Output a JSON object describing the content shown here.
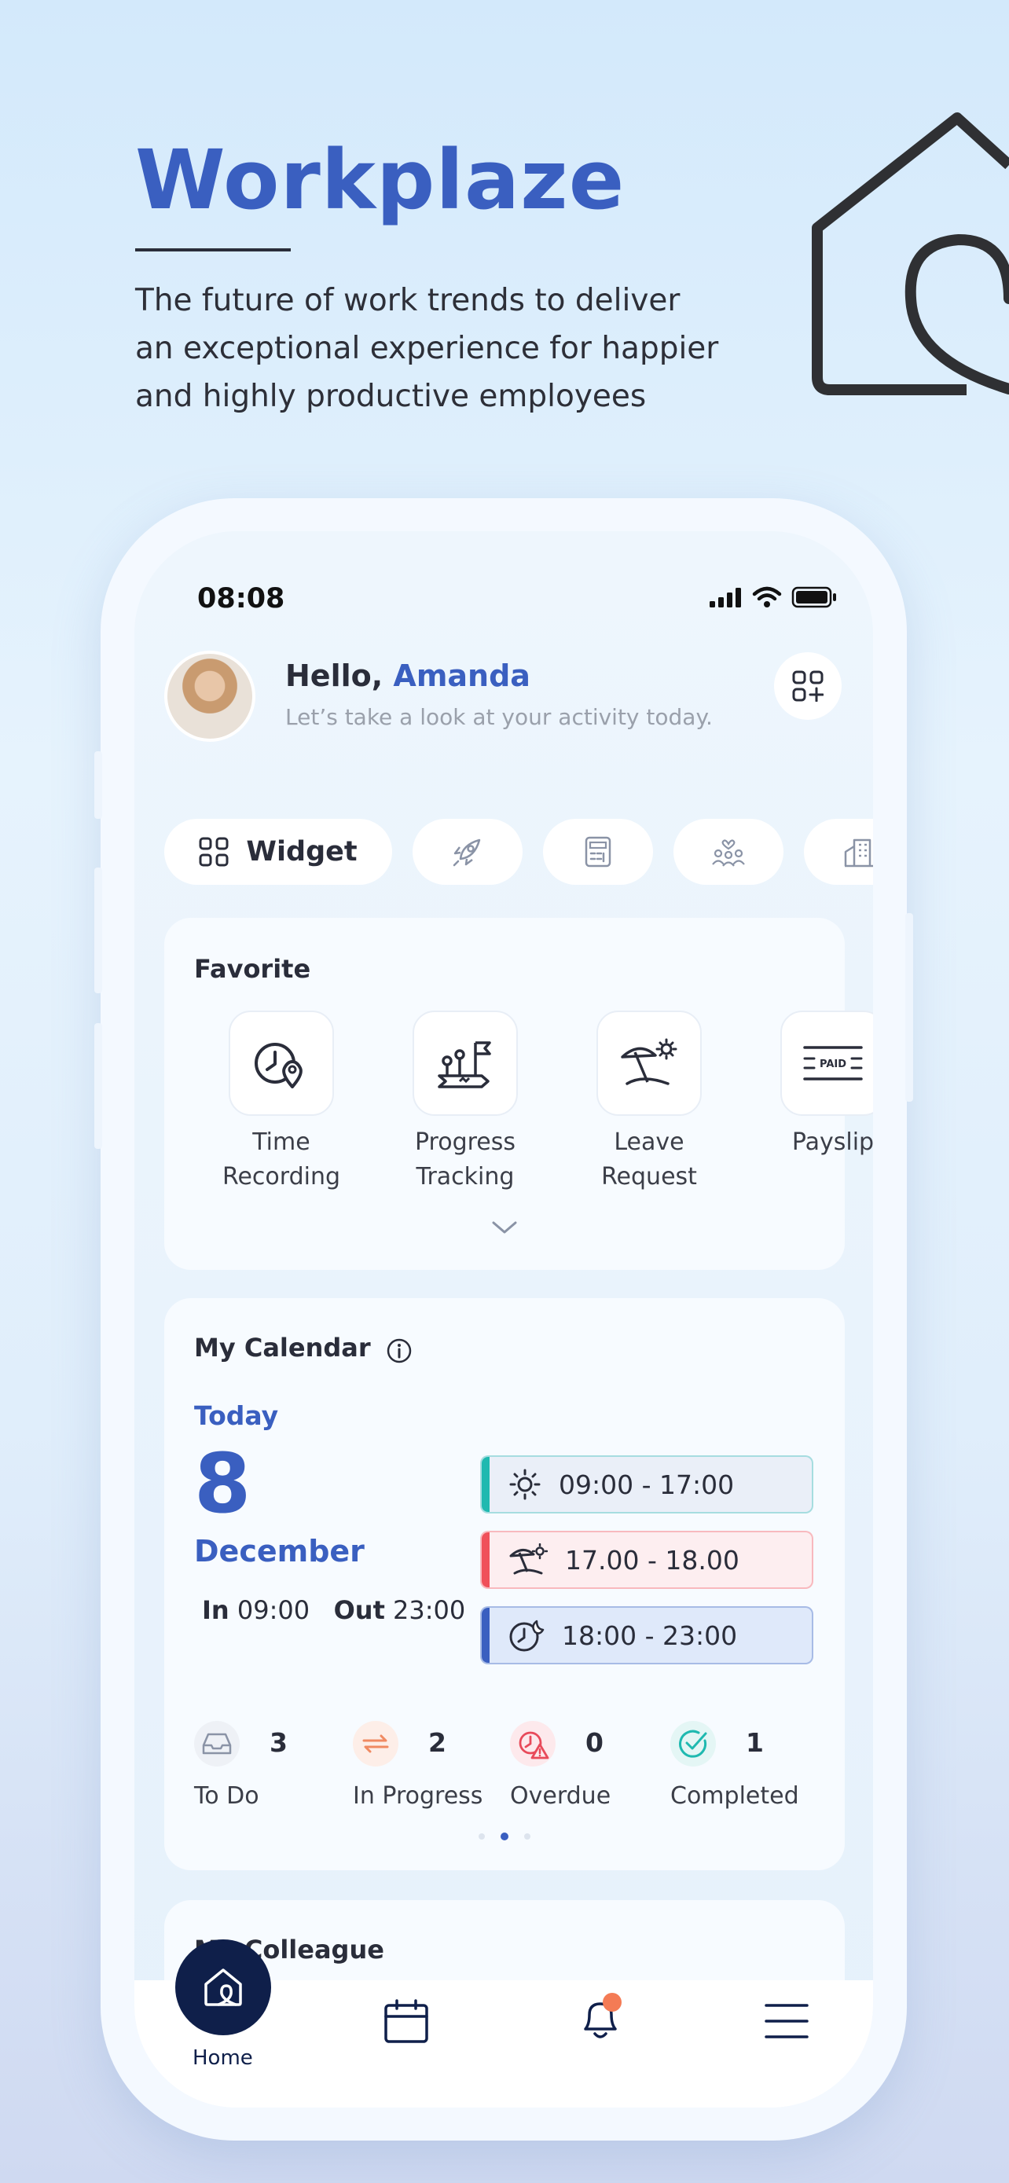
{
  "hero": {
    "title": "Workplaze",
    "subtitle_lines": [
      "The future of work trends to deliver",
      "an exceptional experience for happier",
      "and highly productive employees"
    ]
  },
  "status_bar": {
    "time": "08:08"
  },
  "header": {
    "greeting": "Hello,",
    "user_name": "Amanda",
    "subtitle": "Let’s take a look at your activity today."
  },
  "chips": {
    "widget_label": "Widget"
  },
  "favorite": {
    "title": "Favorite",
    "items": [
      {
        "line1": "Time",
        "line2": "Recording",
        "icon": "time-recording-icon"
      },
      {
        "line1": "Progress",
        "line2": "Tracking",
        "icon": "progress-tracking-icon"
      },
      {
        "line1": "Leave",
        "line2": "Request",
        "icon": "leave-request-icon"
      },
      {
        "line1": "Payslip",
        "line2": "",
        "icon": "payslip-icon"
      }
    ],
    "payslip_icon_text": "PAID"
  },
  "calendar": {
    "title": "My Calendar",
    "today_label": "Today",
    "day": "8",
    "month": "December",
    "in_label": "In",
    "in_time": "09:00",
    "out_label": "Out",
    "out_time": "23:00",
    "shifts": [
      {
        "time": "09:00 - 17:00",
        "color": "#1fb9b0",
        "bg": "#eaeff8",
        "icon": "sun-icon"
      },
      {
        "time": "17.00 - 18.00",
        "color": "#f0505a",
        "bg": "#fdeef0",
        "icon": "beach-icon"
      },
      {
        "time": "18:00 - 23:00",
        "color": "#3a5fc0",
        "bg": "#dfe9fa",
        "icon": "clock-moon-icon"
      }
    ],
    "stats": [
      {
        "count": "3",
        "label": "To Do",
        "icon": "inbox-icon"
      },
      {
        "count": "2",
        "label": "In Progress",
        "icon": "repeat-icon"
      },
      {
        "count": "0",
        "label": "Overdue",
        "icon": "overdue-icon"
      },
      {
        "count": "1",
        "label": "Completed",
        "icon": "check-icon"
      }
    ]
  },
  "colleague": {
    "title": "My Colleague"
  },
  "tabbar": {
    "home_label": "Home"
  },
  "colors": {
    "brand": "#3a5fc0",
    "navy": "#0f1f4a",
    "notification": "#f47b55"
  }
}
